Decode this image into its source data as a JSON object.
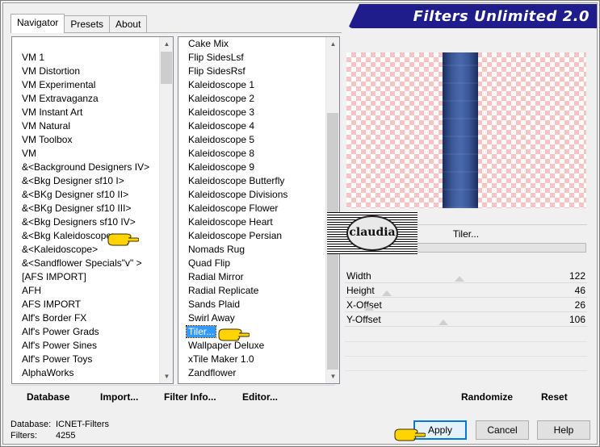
{
  "app": {
    "title": "Filters Unlimited 2.0"
  },
  "tabs": [
    {
      "label": "Navigator",
      "active": true
    },
    {
      "label": "Presets",
      "active": false
    },
    {
      "label": "About",
      "active": false
    }
  ],
  "categories": [
    "VM 1",
    "VM Distortion",
    "VM Experimental",
    "VM Extravaganza",
    "VM Instant Art",
    "VM Natural",
    "VM Toolbox",
    "VM",
    "&<Background Designers IV>",
    "&<Bkg Designer sf10 I>",
    "&<BKg Designer sf10 II>",
    "&<BKg Designer sf10 III>",
    "&<Bkg Designers sf10 IV>",
    "&<Bkg Kaleidoscope>",
    "&<Kaleidoscope>",
    "&<Sandflower Specials\"v\" >",
    "[AFS IMPORT]",
    "AFH",
    "AFS IMPORT",
    "Alf's Border FX",
    "Alf's Power Grads",
    "Alf's Power Sines",
    "Alf's Power Toys",
    "AlphaWorks"
  ],
  "filters": [
    {
      "label": "Cake Mix"
    },
    {
      "label": "Flip SidesLsf"
    },
    {
      "label": "Flip SidesRsf"
    },
    {
      "label": "Kaleidoscope 1"
    },
    {
      "label": "Kaleidoscope 2"
    },
    {
      "label": "Kaleidoscope 3"
    },
    {
      "label": "Kaleidoscope 4"
    },
    {
      "label": "Kaleidoscope 5"
    },
    {
      "label": "Kaleidoscope 8"
    },
    {
      "label": "Kaleidoscope 9"
    },
    {
      "label": "Kaleidoscope Butterfly"
    },
    {
      "label": "Kaleidoscope Divisions"
    },
    {
      "label": "Kaleidoscope Flower"
    },
    {
      "label": "Kaleidoscope Heart"
    },
    {
      "label": "Kaleidoscope Persian"
    },
    {
      "label": "Nomads Rug"
    },
    {
      "label": "Quad Flip"
    },
    {
      "label": "Radial Mirror"
    },
    {
      "label": "Radial Replicate"
    },
    {
      "label": "Sands Plaid"
    },
    {
      "label": "Swirl Away"
    },
    {
      "label": "Tiler...",
      "selected": true
    },
    {
      "label": "Wallpaper Deluxe"
    },
    {
      "label": "xTile Maker 1.0"
    },
    {
      "label": "Zandflower"
    }
  ],
  "selected_filter": "Tiler...",
  "logo_text": "claudia",
  "params": [
    {
      "name": "Width",
      "value": "122"
    },
    {
      "name": "Height",
      "value": "46"
    },
    {
      "name": "X-Offset",
      "value": "26"
    },
    {
      "name": "Y-Offset",
      "value": "106"
    }
  ],
  "toolbar": {
    "database": "Database",
    "import": "Import...",
    "filter_info": "Filter Info...",
    "editor": "Editor...",
    "randomize": "Randomize",
    "reset": "Reset"
  },
  "status": {
    "database_label": "Database:",
    "database_value": "ICNET-Filters",
    "filters_label": "Filters:",
    "filters_value": "4255"
  },
  "buttons": {
    "apply": "Apply",
    "cancel": "Cancel",
    "help": "Help"
  },
  "colors": {
    "banner": "#1f1c8c",
    "selection": "#3399ff",
    "checker": "#f7c3c3",
    "stripe": "#3a5696",
    "pointer": "#ffd400"
  }
}
